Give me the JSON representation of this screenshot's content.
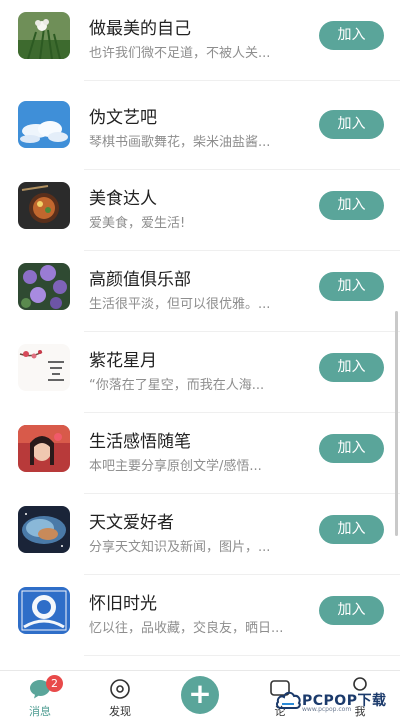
{
  "groups": [
    {
      "title": "做最美的自己",
      "desc": "也许我们微不足道，不被人关...",
      "join_label": "加入",
      "thumb": "white-flower-icon"
    },
    {
      "title": "伪文艺吧",
      "desc": "琴棋书画歌舞花，柴米油盐酱...",
      "join_label": "加入",
      "thumb": "sky-clouds-icon"
    },
    {
      "title": "美食达人",
      "desc": "爱美食，爱生活!",
      "join_label": "加入",
      "thumb": "food-bowl-icon"
    },
    {
      "title": "高颜值俱乐部",
      "desc": "生活很平淡，但可以很优雅。...",
      "join_label": "加入",
      "thumb": "purple-flowers-icon"
    },
    {
      "title": "紫花星月",
      "desc": "“你落在了星空，而我在人海...",
      "join_label": "加入",
      "thumb": "plum-blossom-calligraphy-icon"
    },
    {
      "title": "生活感悟随笔",
      "desc": "本吧主要分享原创文学/感悟...",
      "join_label": "加入",
      "thumb": "woman-red-portrait-icon"
    },
    {
      "title": "天文爱好者",
      "desc": "分享天文知识及新闻，图片，...",
      "join_label": "加入",
      "thumb": "nebula-icon"
    },
    {
      "title": "怀旧时光",
      "desc": "忆以往，品收藏，交良友，晒日...",
      "join_label": "加入",
      "thumb": "blue-illustration-icon"
    }
  ],
  "tabbar": {
    "messages_label": "消息",
    "messages_badge": "2",
    "discover_label": "发现",
    "add_symbol": "+",
    "forum_label": "论",
    "me_label": "我"
  },
  "watermark": {
    "text": "PCPOP下载",
    "sub": "www.pcpop.com"
  },
  "colors": {
    "accent": "#5aa59a",
    "badge": "#e84a4a"
  }
}
